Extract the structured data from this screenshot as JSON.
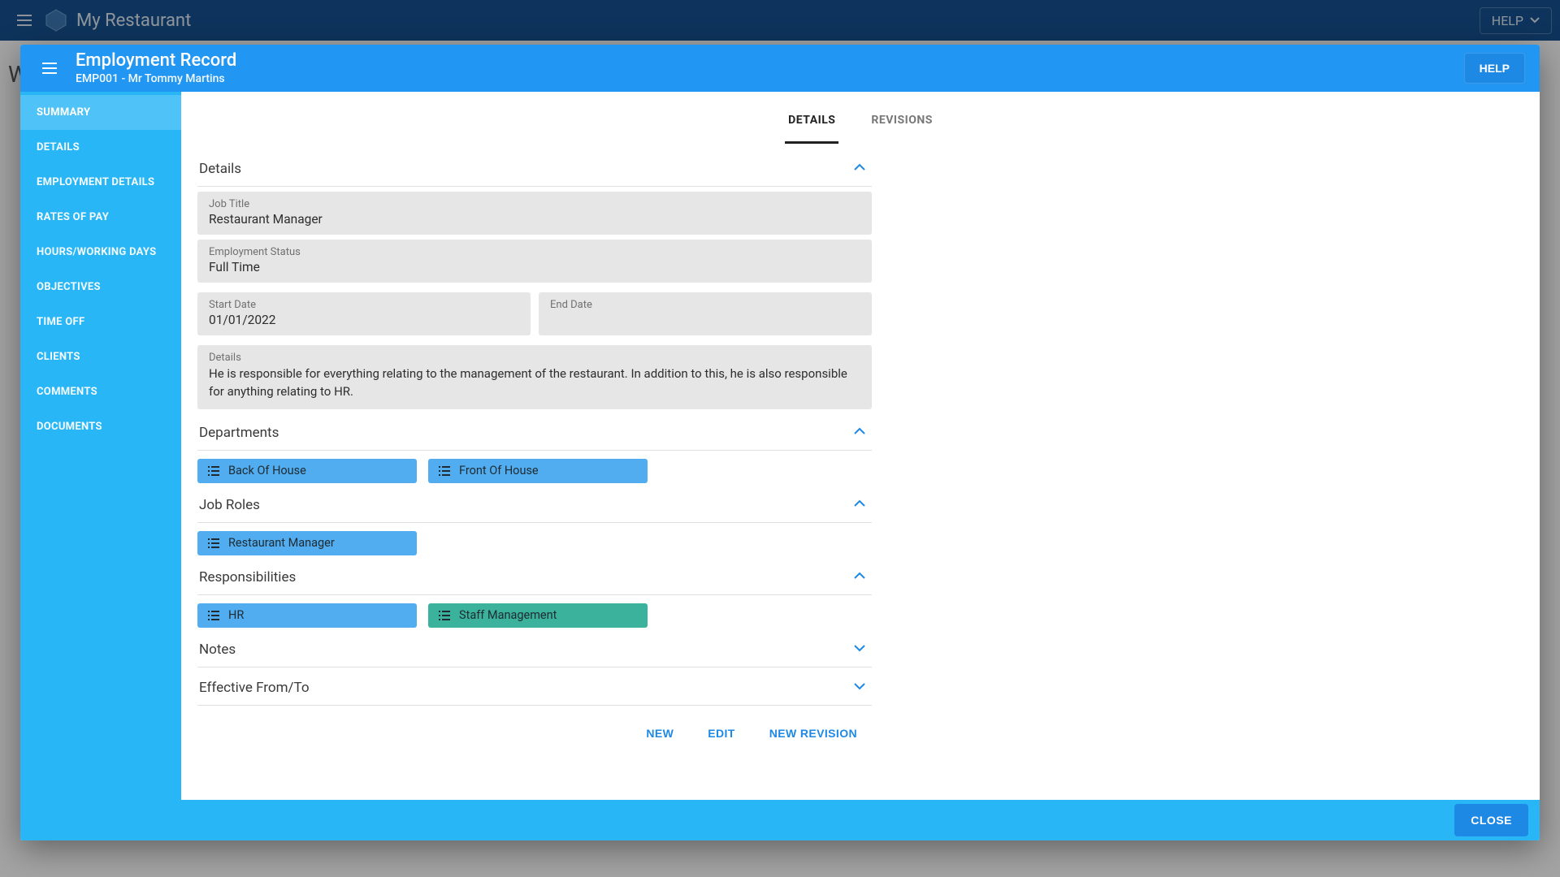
{
  "appbar": {
    "title": "My Restaurant",
    "help_label": "HELP"
  },
  "background_letter": "W",
  "dialog": {
    "title": "Employment Record",
    "subtitle": "EMP001 - Mr Tommy Martins",
    "help_label": "HELP",
    "close_label": "CLOSE"
  },
  "sidebar": {
    "items": [
      {
        "label": "SUMMARY",
        "active": true
      },
      {
        "label": "DETAILS"
      },
      {
        "label": "EMPLOYMENT DETAILS"
      },
      {
        "label": "RATES OF PAY"
      },
      {
        "label": "HOURS/WORKING DAYS"
      },
      {
        "label": "OBJECTIVES"
      },
      {
        "label": "TIME OFF"
      },
      {
        "label": "CLIENTS"
      },
      {
        "label": "COMMENTS"
      },
      {
        "label": "DOCUMENTS"
      }
    ]
  },
  "tabs": {
    "details": "DETAILS",
    "revisions": "REVISIONS"
  },
  "sections": {
    "details": "Details",
    "departments": "Departments",
    "job_roles": "Job Roles",
    "responsibilities": "Responsibilities",
    "notes": "Notes",
    "effective": "Effective From/To"
  },
  "fields": {
    "job_title": {
      "label": "Job Title",
      "value": "Restaurant Manager"
    },
    "emp_status": {
      "label": "Employment Status",
      "value": "Full Time"
    },
    "start_date": {
      "label": "Start Date",
      "value": "01/01/2022"
    },
    "end_date": {
      "label": "End Date",
      "value": ""
    },
    "details": {
      "label": "Details",
      "value": "He is responsible for everything relating to the management of the restaurant. In addition to this, he is also responsible for anything relating to HR."
    }
  },
  "departments": [
    {
      "label": "Back Of House"
    },
    {
      "label": "Front Of House"
    }
  ],
  "job_roles": [
    {
      "label": "Restaurant Manager"
    }
  ],
  "responsibilities": [
    {
      "label": "HR",
      "color": "blue"
    },
    {
      "label": "Staff Management",
      "color": "green"
    }
  ],
  "actions": {
    "new": "NEW",
    "edit": "EDIT",
    "new_revision": "NEW REVISION"
  }
}
